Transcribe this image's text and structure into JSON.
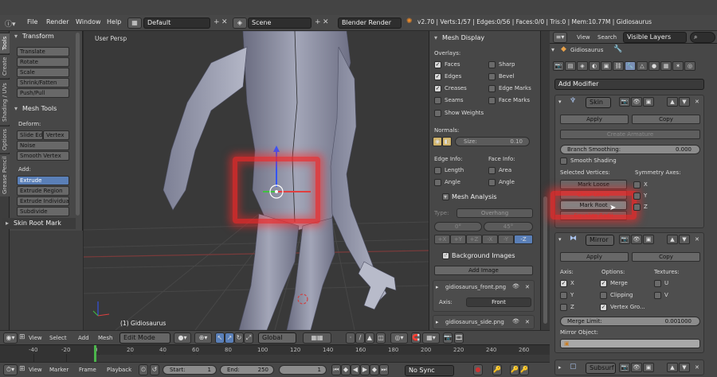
{
  "info_bar": {
    "menus": [
      "File",
      "Render",
      "Window",
      "Help"
    ],
    "layout": "Default",
    "scene": "Scene",
    "engine": "Blender Render",
    "stats": "v2.70 | Verts:1/57 | Edges:0/56 | Faces:0/0 | Tris:0 | Mem:10.77M | Gidiosaurus"
  },
  "tool_tabs": [
    "Tools",
    "Create",
    "Shading / UVs",
    "Options",
    "Grease Pencil"
  ],
  "tool_shelf": {
    "transform_header": "Transform",
    "transform_buttons": [
      "Translate",
      "Rotate",
      "Scale",
      "Shrink/Fatten",
      "Push/Pull"
    ],
    "mesh_tools_header": "Mesh Tools",
    "deform_label": "Deform:",
    "deform_buttons": [
      "Slide Ed",
      "Vertex",
      "Noise",
      "Smooth Vertex"
    ],
    "add_label": "Add:",
    "add_buttons": [
      "Extrude",
      "Extrude Region",
      "Extrude Individual",
      "Subdivide"
    ],
    "skin_root_header": "Skin Root Mark"
  },
  "viewport": {
    "view_name": "User Persp",
    "object_name": "(1) Gidiosaurus"
  },
  "npanel": {
    "mesh_display_header": "Mesh Display",
    "overlays_label": "Overlays:",
    "overlays": [
      {
        "label": "Faces",
        "on": true
      },
      {
        "label": "Edges",
        "on": true
      },
      {
        "label": "Creases",
        "on": true
      },
      {
        "label": "Seams",
        "on": false
      }
    ],
    "overlays_right": [
      {
        "label": "Sharp",
        "on": false
      },
      {
        "label": "Bevel",
        "on": false
      },
      {
        "label": "Edge Marks",
        "on": false
      },
      {
        "label": "Face Marks",
        "on": false
      }
    ],
    "show_weights": "Show Weights",
    "normals_label": "Normals:",
    "size_label": "Size:",
    "size_value": "0.10",
    "edge_info_label": "Edge Info:",
    "face_info_label": "Face Info:",
    "edge_info": [
      "Length",
      "Angle"
    ],
    "face_info": [
      "Area",
      "Angle"
    ],
    "mesh_analysis_header": "Mesh Analysis",
    "type_label": "Type:",
    "type_value": "Overhang",
    "angle_min": "0°",
    "angle_max": "45°",
    "axis_buttons": [
      "+X",
      "+Y",
      "+Z",
      "-X",
      "-Y",
      "-Z"
    ],
    "bg_images_header": "Background Images",
    "add_image": "Add Image",
    "image1": "gidiosaurus_front.png",
    "axis_label": "Axis:",
    "axis_value": "Front",
    "image2": "gidiosaurus_side.png"
  },
  "outliner": {
    "view": "View",
    "search": "Search",
    "filter": "Visible Layers"
  },
  "properties": {
    "object_name": "Gidiosaurus",
    "add_modifier": "Add Modifier",
    "skin": {
      "name": "Skin",
      "apply": "Apply",
      "copy": "Copy",
      "create_armature": "Create Armature",
      "branch_label": "Branch Smoothing:",
      "branch_value": "0.000",
      "smooth_shading": "Smooth Shading",
      "selected_vertices": "Selected Vertices:",
      "symmetry_axes": "Symmetry Axes:",
      "mark_loose": "Mark Loose",
      "clear_loose": "Clear Loose",
      "mark_root": "Mark Root",
      "equalize_radii": "Equalize Radii",
      "axes": [
        {
          "label": "X",
          "on": false
        },
        {
          "label": "Y",
          "on": false
        },
        {
          "label": "Z",
          "on": false
        }
      ]
    },
    "mirror": {
      "name": "Mirror",
      "apply": "Apply",
      "copy": "Copy",
      "axis_label": "Axis:",
      "options_label": "Options:",
      "textures_label": "Textures:",
      "axis": [
        {
          "label": "X",
          "on": true
        },
        {
          "label": "Y",
          "on": false
        },
        {
          "label": "Z",
          "on": false
        }
      ],
      "options": [
        {
          "label": "Merge",
          "on": true
        },
        {
          "label": "Clipping",
          "on": false
        },
        {
          "label": "Vertex Gro...",
          "on": true
        }
      ],
      "textures": [
        {
          "label": "U",
          "on": false
        },
        {
          "label": "V",
          "on": false
        }
      ],
      "merge_limit_label": "Merge Limit:",
      "merge_limit_value": "0.001000",
      "mirror_object_label": "Mirror Object:"
    },
    "subsurf": {
      "name": "Subsurf"
    }
  },
  "viewport_header": {
    "menus": [
      "View",
      "Select",
      "Add",
      "Mesh"
    ],
    "mode": "Edit Mode",
    "orientation": "Global"
  },
  "timeline": {
    "ticks": [
      "-40",
      "-20",
      "0",
      "20",
      "40",
      "60",
      "80",
      "100",
      "120",
      "140",
      "160",
      "180",
      "200",
      "220",
      "240",
      "260"
    ]
  },
  "timeline_header": {
    "menus": [
      "View",
      "Marker",
      "Frame",
      "Playback"
    ],
    "start_label": "Start:",
    "start_value": "1",
    "end_label": "End:",
    "end_value": "250",
    "current_frame": "1",
    "sync": "No Sync"
  },
  "colors": {
    "highlight": "#f02828",
    "accent_blue": "#5a7fb7"
  }
}
